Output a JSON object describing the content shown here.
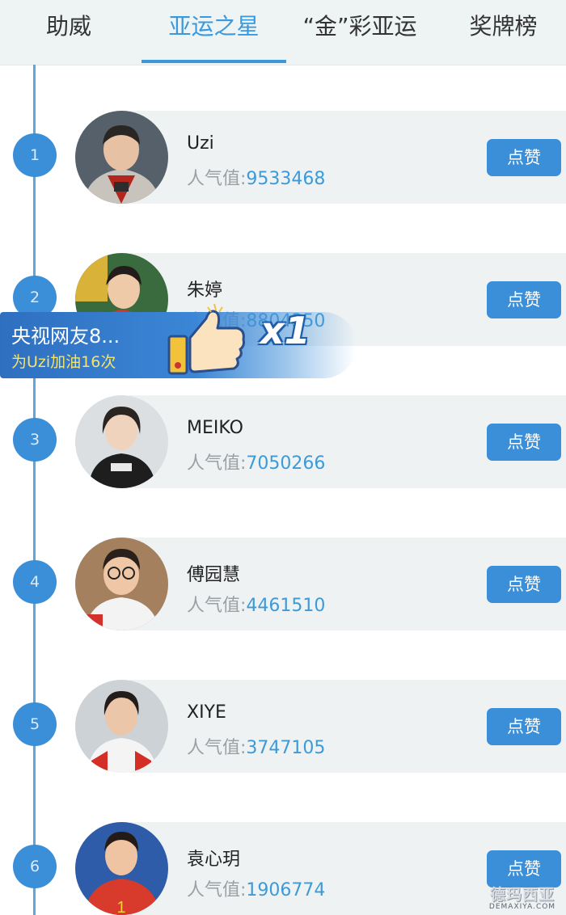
{
  "tabs": [
    {
      "label": "助威",
      "active": false
    },
    {
      "label": "亚运之星",
      "active": true
    },
    {
      "label": "“金”彩亚运",
      "active": false
    },
    {
      "label": "奖牌榜",
      "active": false
    }
  ],
  "colors": {
    "accent": "#3a98dc",
    "rank_badge": "#3a8fd8",
    "card_bg": "#eef2f3",
    "pop_value": "#3d9ad8"
  },
  "list": {
    "pop_label": "人气值:",
    "like_label": "点赞",
    "items": [
      {
        "rank": "1",
        "name": "Uzi",
        "popularity": "9533468"
      },
      {
        "rank": "2",
        "name": "朱婷",
        "popularity": "8804350"
      },
      {
        "rank": "3",
        "name": "MEIKO",
        "popularity": "7050266"
      },
      {
        "rank": "4",
        "name": "傅园慧",
        "popularity": "4461510"
      },
      {
        "rank": "5",
        "name": "XIYE",
        "popularity": "3747105"
      },
      {
        "rank": "6",
        "name": "袁心玥",
        "popularity": "1906774"
      }
    ]
  },
  "banner": {
    "line1": "央视网友8...",
    "line2": "为Uzi加油16次",
    "multiplier": "x1",
    "icon": "thumbs-up-icon"
  },
  "watermark": {
    "line1": "德玛西亚",
    "line2": "DEMAXIYA.COM"
  }
}
